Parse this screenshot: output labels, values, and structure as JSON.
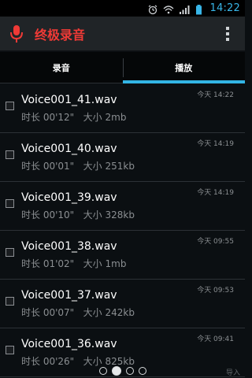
{
  "status_bar": {
    "time": "14:22",
    "icons": [
      "alarm-icon",
      "wifi-icon",
      "signal-icon",
      "battery-icon"
    ]
  },
  "app": {
    "title": "终极录音",
    "icon": "microphone-icon",
    "title_color": "#ef3a36"
  },
  "tabs": [
    {
      "label": "录音",
      "active": false
    },
    {
      "label": "播放",
      "active": true
    }
  ],
  "accent_color": "#33b5e5",
  "recordings": [
    {
      "name": "Voice001_41.wav",
      "duration_label": "时长",
      "duration": "00'12\"",
      "size_label": "大小",
      "size": "2mb",
      "time": "今天 14:22"
    },
    {
      "name": "Voice001_40.wav",
      "duration_label": "时长",
      "duration": "00'01\"",
      "size_label": "大小",
      "size": "251kb",
      "time": "今天 14:19"
    },
    {
      "name": "Voice001_39.wav",
      "duration_label": "时长",
      "duration": "00'10\"",
      "size_label": "大小",
      "size": "328kb",
      "time": "今天 14:19"
    },
    {
      "name": "Voice001_38.wav",
      "duration_label": "时长",
      "duration": "01'02\"",
      "size_label": "大小",
      "size": "1mb",
      "time": "今天 09:55"
    },
    {
      "name": "Voice001_37.wav",
      "duration_label": "时长",
      "duration": "00'07\"",
      "size_label": "大小",
      "size": "242kb",
      "time": "今天 09:53"
    },
    {
      "name": "Voice001_36.wav",
      "duration_label": "时长",
      "duration": "00'26\"",
      "size_label": "大小",
      "size": "825kb",
      "time": "今天 09:41"
    }
  ],
  "pager": {
    "count": 4,
    "active_index": 1,
    "corner_text": "导入"
  }
}
